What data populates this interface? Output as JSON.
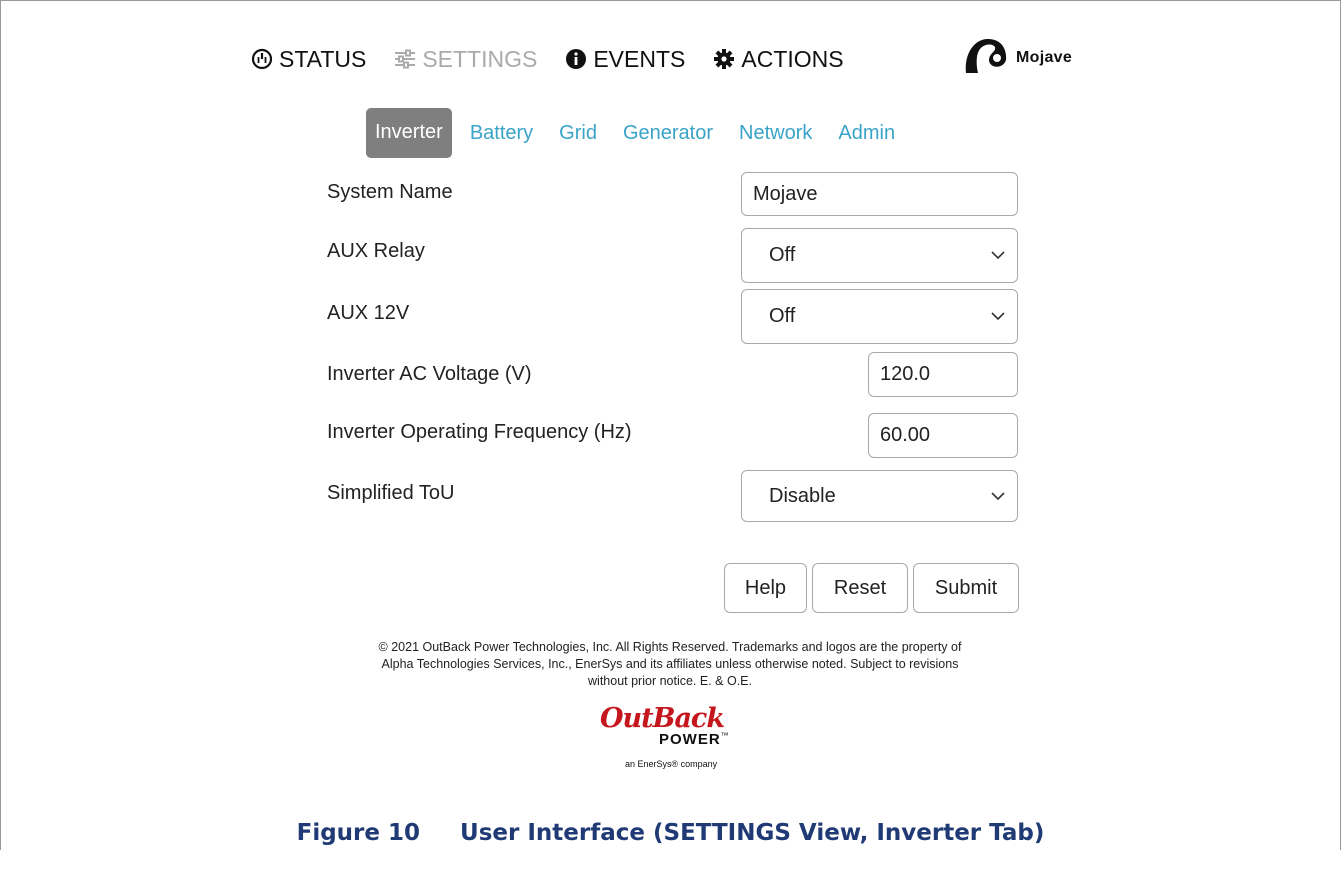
{
  "nav": {
    "status": "STATUS",
    "settings": "SETTINGS",
    "events": "EVENTS",
    "actions": "ACTIONS",
    "user_name": "Mojave"
  },
  "tabs": [
    {
      "label": "Inverter",
      "active": true
    },
    {
      "label": "Battery"
    },
    {
      "label": "Grid"
    },
    {
      "label": "Generator"
    },
    {
      "label": "Network"
    },
    {
      "label": "Admin"
    }
  ],
  "form": {
    "system_name": {
      "label": "System Name",
      "value": "Mojave"
    },
    "aux_relay": {
      "label": "AUX Relay",
      "value": "Off"
    },
    "aux_12v": {
      "label": "AUX 12V",
      "value": "Off"
    },
    "ac_voltage": {
      "label": "Inverter AC Voltage (V)",
      "value": "120.0"
    },
    "frequency": {
      "label": "Inverter Operating Frequency (Hz)",
      "value": "60.00"
    },
    "tou": {
      "label": "Simplified ToU",
      "value": "Disable"
    }
  },
  "buttons": {
    "help": "Help",
    "reset": "Reset",
    "submit": "Submit"
  },
  "footer": {
    "line1": "© 2021 OutBack Power Technologies, Inc. All Rights Reserved. Trademarks and logos are the property of",
    "line2": "Alpha Technologies Services, Inc., EnerSys and its affiliates unless otherwise noted. Subject to revisions",
    "line3": "without prior notice. E. & O.E."
  },
  "logo": {
    "brand": "OutBack",
    "power": "POWER",
    "tm": "™",
    "tagline": "an EnerSys® company"
  },
  "caption": "Figure 10     User Interface (SETTINGS View, Inverter Tab)",
  "colors": {
    "tab_link": "#3aa3c8",
    "tab_active_bg": "#7f7f7f",
    "logo_red": "#c4161c",
    "caption": "#1f3a75"
  }
}
